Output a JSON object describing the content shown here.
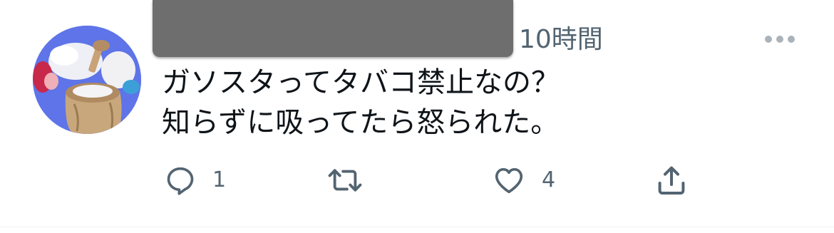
{
  "tweet": {
    "timestamp": "10時間",
    "text_lines": [
      "ガソスタってタバコ禁止なの？",
      "知らずに吸ってたら怒られた。"
    ]
  },
  "actions": {
    "reply": {
      "icon": "reply-icon",
      "count": "1"
    },
    "retweet": {
      "icon": "retweet-icon",
      "count": ""
    },
    "like": {
      "icon": "heart-icon",
      "count": "4"
    },
    "share": {
      "icon": "share-icon"
    }
  },
  "colors": {
    "text": "#0f1419",
    "secondary": "#536471",
    "avatar_bg": "#5e74e8",
    "redaction": "#6e6e6e"
  }
}
